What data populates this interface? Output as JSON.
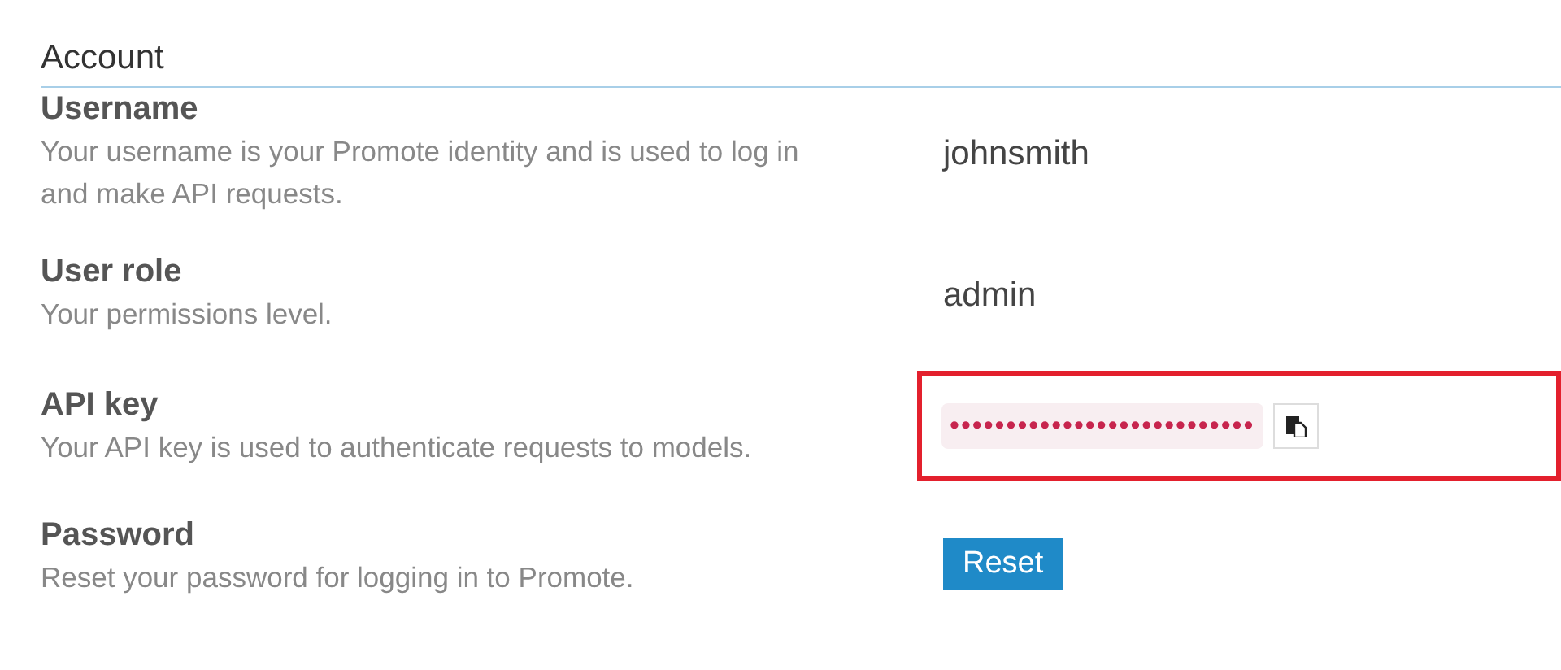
{
  "section": {
    "title": "Account"
  },
  "settings": [
    {
      "kind": "text",
      "label": "Username",
      "description": "Your username is your Promote identity and is used to log in and make API requests.",
      "value": "johnsmith"
    },
    {
      "kind": "text",
      "label": "User role",
      "description": "Your permissions level.",
      "value": "admin"
    },
    {
      "kind": "secret",
      "label": "API key",
      "description": "Your API key is used to authenticate requests to models.",
      "value": "•••••••••••••••••••••••••••",
      "highlighted": true
    },
    {
      "kind": "button",
      "label": "Password",
      "description": "Reset your password for logging in to Promote.",
      "value": "Reset"
    }
  ]
}
